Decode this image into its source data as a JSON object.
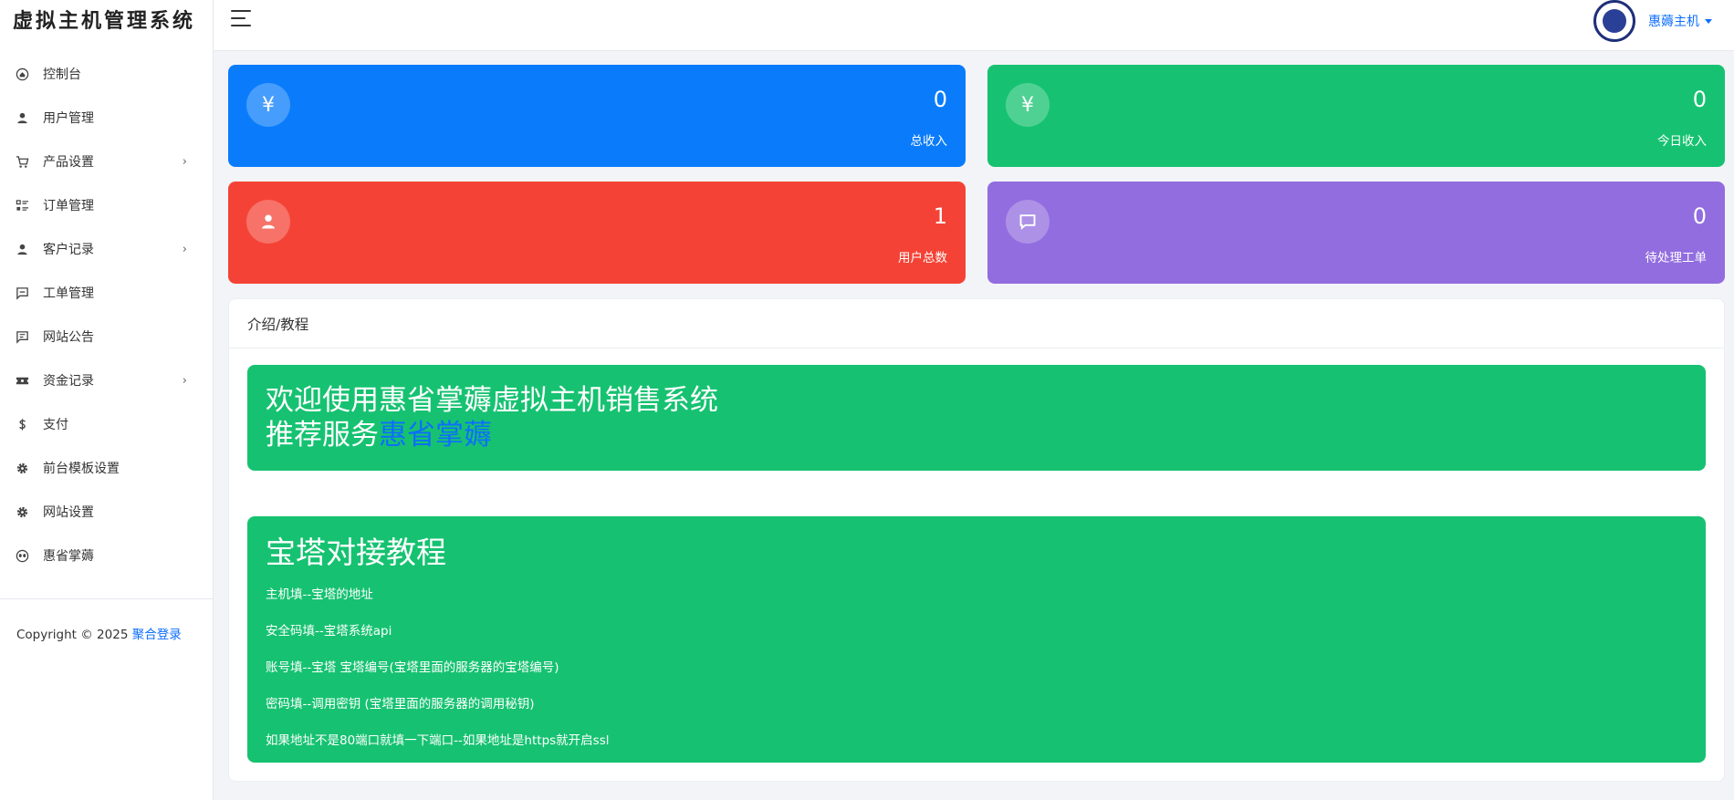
{
  "sidebar": {
    "brand": "虚拟主机管理系统",
    "items": [
      {
        "label": "控制台",
        "icon": "home-icon",
        "has_submenu": false
      },
      {
        "label": "用户管理",
        "icon": "user-icon",
        "has_submenu": false
      },
      {
        "label": "产品设置",
        "icon": "cart-icon",
        "has_submenu": true
      },
      {
        "label": "订单管理",
        "icon": "list-icon",
        "has_submenu": false
      },
      {
        "label": "客户记录",
        "icon": "user-icon",
        "has_submenu": true
      },
      {
        "label": "工单管理",
        "icon": "message-icon",
        "has_submenu": false
      },
      {
        "label": "网站公告",
        "icon": "message-icon",
        "has_submenu": false
      },
      {
        "label": "资金记录",
        "icon": "ticket-icon",
        "has_submenu": true
      },
      {
        "label": "支付",
        "icon": "dollar-icon",
        "has_submenu": false
      },
      {
        "label": "前台模板设置",
        "icon": "gear-icon",
        "has_submenu": false
      },
      {
        "label": "网站设置",
        "icon": "gear-icon",
        "has_submenu": false
      },
      {
        "label": "惠省掌薅",
        "icon": "alien-icon",
        "has_submenu": false
      }
    ],
    "submenu_chevron": "›",
    "copyright_text": "Copyright © 2025",
    "copyright_link": "聚合登录"
  },
  "topbar": {
    "user_name": "惠薅主机"
  },
  "stats": [
    {
      "value": "0",
      "label": "总收入",
      "icon": "yen-icon",
      "color": "#0a7cfb"
    },
    {
      "value": "0",
      "label": "今日收入",
      "icon": "yen-icon",
      "color": "#16c271"
    },
    {
      "value": "1",
      "label": "用户总数",
      "icon": "user-icon",
      "color": "#f44336"
    },
    {
      "value": "0",
      "label": "待处理工单",
      "icon": "chat-icon",
      "color": "#926ddf"
    }
  ],
  "intro": {
    "title": "介绍/教程",
    "welcome_line1": "欢迎使用惠省掌薅虚拟主机销售系统",
    "welcome_line2_prefix": "推荐服务",
    "welcome_line2_link": "惠省掌薅",
    "tutorial_title": "宝塔对接教程",
    "tutorial_lines": [
      "主机填--宝塔的地址",
      "安全码填--宝塔系统api",
      "账号填--宝塔 宝塔编号(宝塔里面的服务器的宝塔编号)",
      "密码填--调用密钥 (宝塔里面的服务器的调用秘钥)",
      "如果地址不是80端口就填一下端口--如果地址是https就开启ssl"
    ]
  },
  "colors": {
    "accent": "#0d6efd",
    "green": "#16c271"
  }
}
